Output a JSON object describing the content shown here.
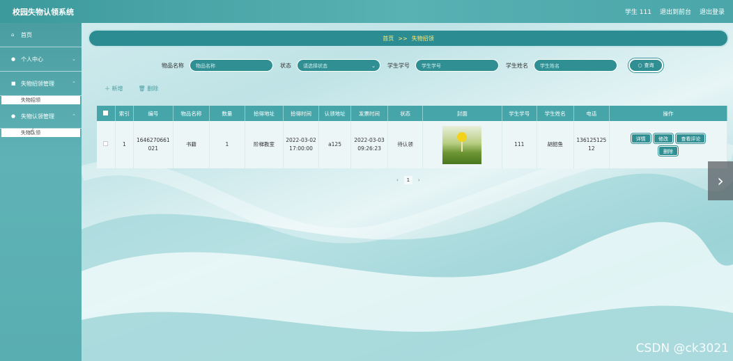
{
  "app": {
    "title": "校园失物认领系统",
    "user_label": "学生 111",
    "back_label": "退出到前台",
    "logout_label": "退出登录"
  },
  "sidebar": {
    "items": [
      {
        "label": "首页",
        "icon": "home-icon"
      },
      {
        "label": "个人中心",
        "icon": "user-icon"
      },
      {
        "label": "失物招领管理",
        "icon": "briefcase-icon",
        "sub": "失物招领"
      },
      {
        "label": "失物认领管理",
        "icon": "user-icon",
        "sub": "失物认领"
      }
    ]
  },
  "breadcrumb": {
    "home": "首页",
    "sep": ">>",
    "current": "失物招领"
  },
  "search": {
    "name_label": "物品名称",
    "name_placeholder": "物品名称",
    "status_label": "状态",
    "status_placeholder": "请选择状态",
    "stuno_label": "学生学号",
    "stuno_placeholder": "学生学号",
    "stuname_label": "学生姓名",
    "stuname_placeholder": "学生姓名",
    "button": "查询"
  },
  "actions": {
    "add": "新增",
    "delete": "删除"
  },
  "table": {
    "headers": [
      "索引",
      "编号",
      "物品名称",
      "数量",
      "拾得地址",
      "拾得时间",
      "认领地址",
      "发票时间",
      "状态",
      "封面",
      "学生学号",
      "学生姓名",
      "电话",
      "操作"
    ],
    "rows": [
      {
        "index": "1",
        "code": "1646270661021",
        "name": "书籍",
        "qty": "1",
        "found_addr": "阶梯教室",
        "found_time": "2022-03-02 17:00:00",
        "claim_addr": "a125",
        "publish_time": "2022-03-03 09:26:23",
        "status": "待认领",
        "stuno": "111",
        "stuname": "胡韶鱼",
        "phone": "13612512512",
        "ops": {
          "detail": "详情",
          "edit": "修改",
          "comment": "查看评论",
          "delete": "删除"
        }
      }
    ]
  },
  "pager": {
    "prev": "‹",
    "page": "1",
    "next": "›"
  },
  "watermark": "CSDN @ck3021",
  "colors": {
    "primary": "#2f8f93",
    "header": "#46a5a9",
    "breadcrumb_text": "#ffe97a"
  }
}
